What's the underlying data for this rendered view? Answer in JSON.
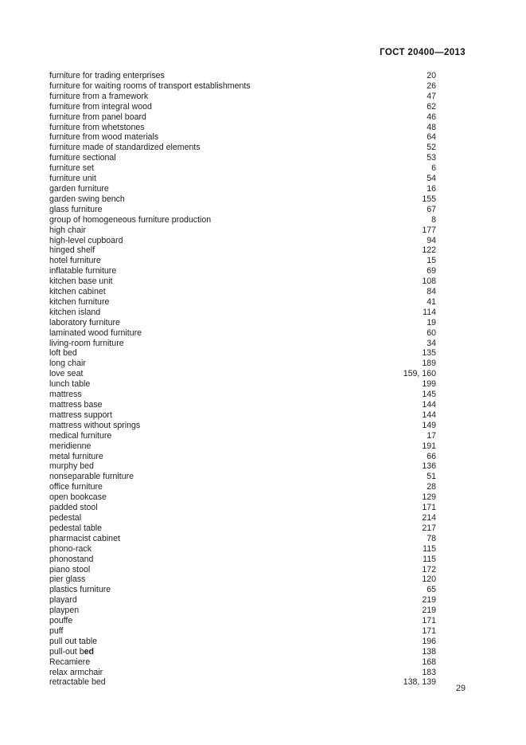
{
  "document": {
    "header": "ГОСТ 20400—2013",
    "footer_page_number": "29"
  },
  "index": {
    "entries": [
      {
        "term": "furniture for trading enterprises",
        "pages": "20"
      },
      {
        "term": "furniture for waiting rooms of transport establishments",
        "pages": "26"
      },
      {
        "term": "furniture from a framework",
        "pages": "47"
      },
      {
        "term": "furniture from integral wood",
        "pages": "62"
      },
      {
        "term": "furniture from panel board",
        "pages": "46"
      },
      {
        "term": "furniture from whetstones",
        "pages": "48"
      },
      {
        "term": "furniture from wood materials",
        "pages": "64"
      },
      {
        "term": "furniture made of standardized elements",
        "pages": "52"
      },
      {
        "term": "furniture sectional",
        "pages": "53"
      },
      {
        "term": "furniture set",
        "pages": "6"
      },
      {
        "term": "furniture unit",
        "pages": "54"
      },
      {
        "term": "garden furniture",
        "pages": "16"
      },
      {
        "term": "garden swing bench",
        "pages": "155"
      },
      {
        "term": "glass furniture",
        "pages": "67"
      },
      {
        "term": "group of homogeneous furniture production",
        "pages": "8"
      },
      {
        "term": "high chair",
        "pages": "177"
      },
      {
        "term": "high-level cupboard",
        "pages": "94"
      },
      {
        "term": "hinged shelf",
        "pages": "122"
      },
      {
        "term": "hotel furniture",
        "pages": "15"
      },
      {
        "term": "inflatable furniture",
        "pages": "69"
      },
      {
        "term": "kitchen base unit",
        "pages": "108"
      },
      {
        "term": "kitchen cabinet",
        "pages": "84"
      },
      {
        "term": "kitchen furniture",
        "pages": "41"
      },
      {
        "term": "kitchen island",
        "pages": "114"
      },
      {
        "term": "laboratory furniture",
        "pages": "19"
      },
      {
        "term": "laminated wood furniture",
        "pages": "60"
      },
      {
        "term": "living-room furniture",
        "pages": "34"
      },
      {
        "term": "loft bed",
        "pages": "135"
      },
      {
        "term": "long chair",
        "pages": "189"
      },
      {
        "term": "love seat",
        "pages": "159, 160"
      },
      {
        "term": "lunch table",
        "pages": "199"
      },
      {
        "term": "mattress",
        "pages": "145"
      },
      {
        "term": "mattress base",
        "pages": "144"
      },
      {
        "term": "mattress support",
        "pages": "144"
      },
      {
        "term": "mattress without springs",
        "pages": "149"
      },
      {
        "term": "medical furniture",
        "pages": "17"
      },
      {
        "term": "meridienne",
        "pages": "191"
      },
      {
        "term": "metal furniture",
        "pages": "66"
      },
      {
        "term": "murphy bed",
        "pages": "136"
      },
      {
        "term": "nonseparable furniture",
        "pages": "51"
      },
      {
        "term": "office furniture",
        "pages": "28"
      },
      {
        "term": "open bookcase",
        "pages": "129"
      },
      {
        "term": "padded stool",
        "pages": "171"
      },
      {
        "term": "pedestal",
        "pages": "214"
      },
      {
        "term": "pedestal table",
        "pages": "217"
      },
      {
        "term": "pharmacist cabinet",
        "pages": "78"
      },
      {
        "term": "phono-rack",
        "pages": "115"
      },
      {
        "term": "phonostand",
        "pages": "115"
      },
      {
        "term": "piano stool",
        "pages": "172"
      },
      {
        "term": "pier glass",
        "pages": "120"
      },
      {
        "term": "plastics furniture",
        "pages": "65"
      },
      {
        "term": "playard",
        "pages": "219"
      },
      {
        "term": "playpen",
        "pages": "219"
      },
      {
        "term": "pouffe",
        "pages": "171"
      },
      {
        "term": "puff",
        "pages": "171"
      },
      {
        "term": "pull out table",
        "pages": "196"
      },
      {
        "term": "pull-out bed",
        "term_prefix": "pull-out b",
        "term_emphasis": "ed",
        "pages": "138"
      },
      {
        "term": "Recamiere",
        "pages": "168"
      },
      {
        "term": "relax armchair",
        "pages": "183"
      },
      {
        "term": "retractable bed",
        "pages": "138, 139"
      }
    ]
  }
}
